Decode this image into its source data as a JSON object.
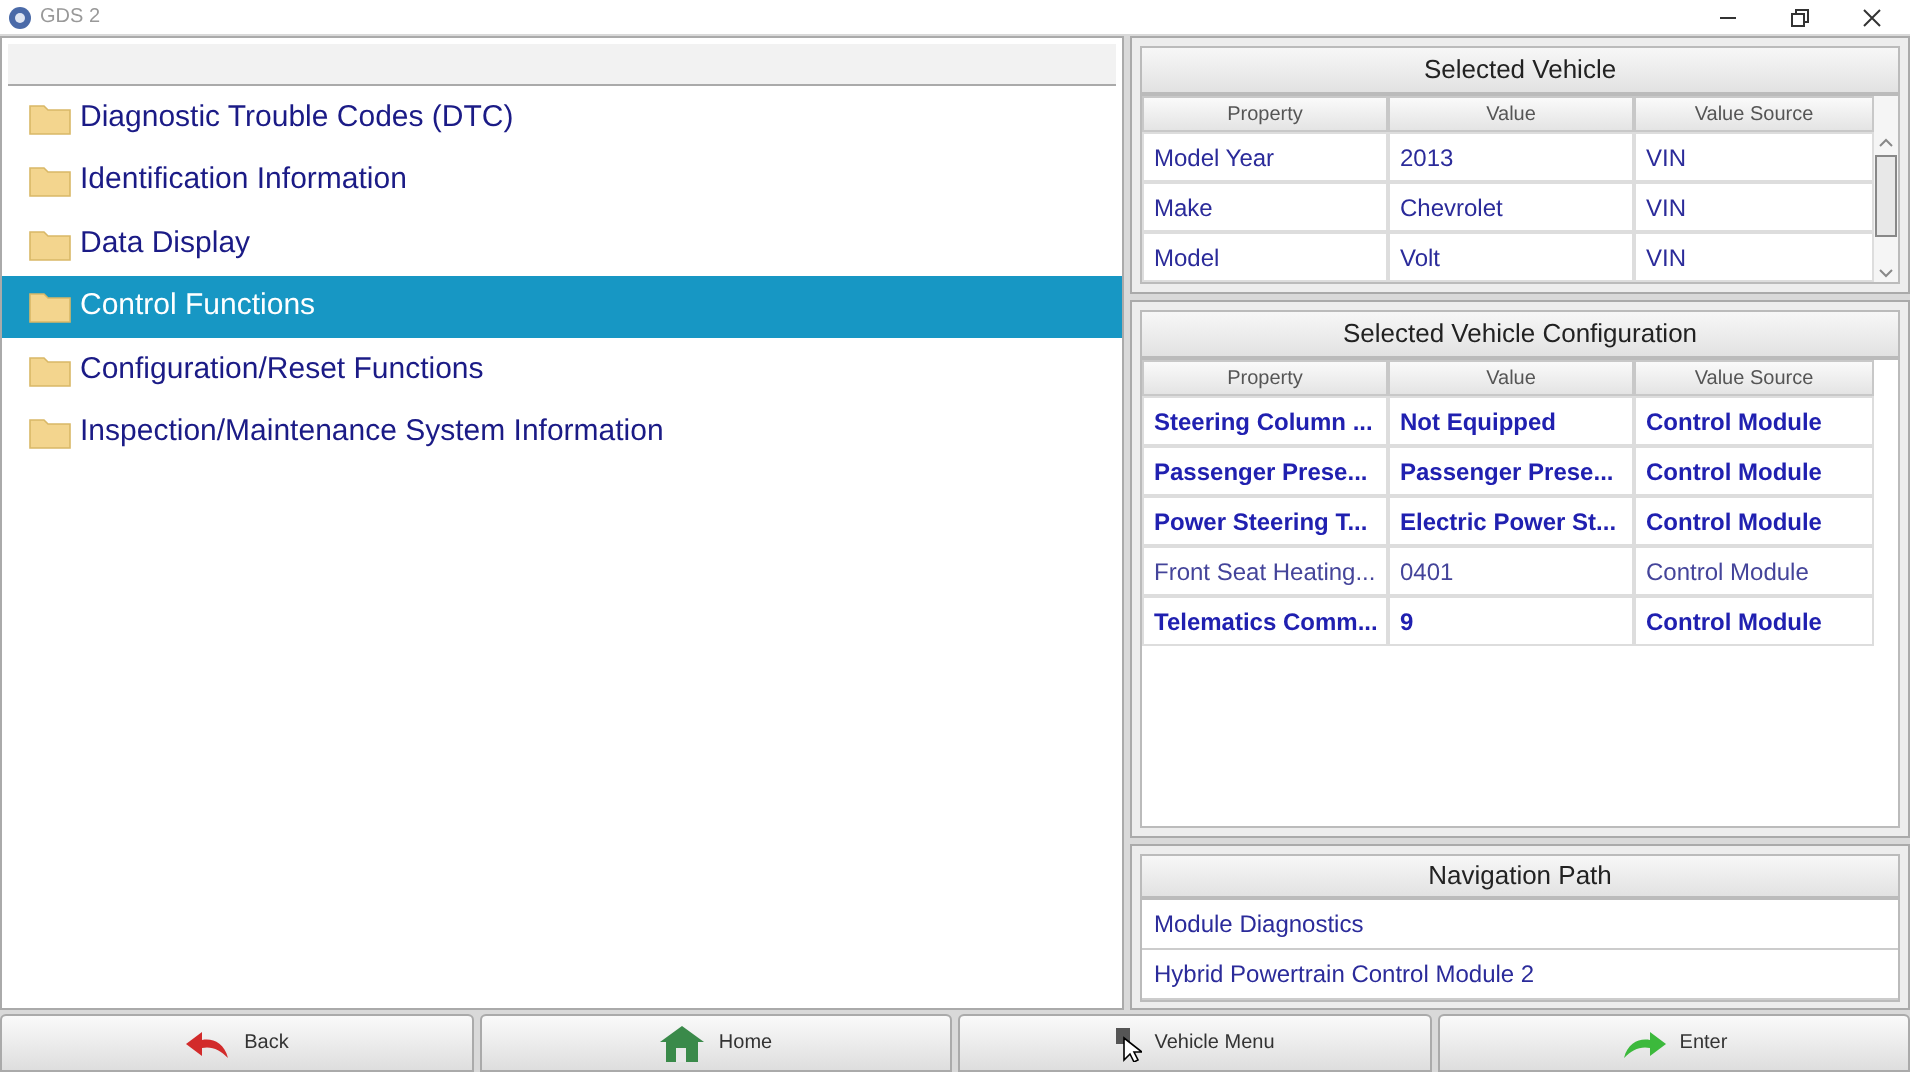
{
  "window": {
    "title": "GDS 2"
  },
  "menu": [
    {
      "label": "Diagnostic Trouble Codes (DTC)",
      "selected": false
    },
    {
      "label": "Identification Information",
      "selected": false
    },
    {
      "label": "Data Display",
      "selected": false
    },
    {
      "label": "Control Functions",
      "selected": true
    },
    {
      "label": "Configuration/Reset Functions",
      "selected": false
    },
    {
      "label": "Inspection/Maintenance System Information",
      "selected": false
    }
  ],
  "selected_vehicle": {
    "title": "Selected Vehicle",
    "columns": [
      "Property",
      "Value",
      "Value Source"
    ],
    "rows": [
      [
        "Model Year",
        "2013",
        "VIN"
      ],
      [
        "Make",
        "Chevrolet",
        "VIN"
      ],
      [
        "Model",
        "Volt",
        "VIN"
      ]
    ]
  },
  "configuration": {
    "title": "Selected Vehicle Configuration",
    "columns": [
      "Property",
      "Value",
      "Value Source"
    ],
    "rows": [
      {
        "cells": [
          "Steering Column ...",
          "Not Equipped",
          "Control Module"
        ],
        "emphasized": true
      },
      {
        "cells": [
          "Passenger Prese...",
          "Passenger Prese...",
          "Control Module"
        ],
        "emphasized": true
      },
      {
        "cells": [
          "Power Steering T...",
          "Electric Power St...",
          "Control Module"
        ],
        "emphasized": true
      },
      {
        "cells": [
          "Front Seat Heating...",
          "0401",
          "Control Module"
        ],
        "emphasized": false
      },
      {
        "cells": [
          "Telematics Comm...",
          "9",
          "Control Module"
        ],
        "emphasized": true
      }
    ]
  },
  "navigation_path": {
    "title": "Navigation Path",
    "items": [
      "Module Diagnostics",
      "Hybrid Powertrain Control Module 2"
    ]
  },
  "buttons": [
    {
      "kind": "back",
      "label": "Back"
    },
    {
      "kind": "home",
      "label": "Home"
    },
    {
      "kind": "vehicle",
      "label": "Vehicle Menu"
    },
    {
      "kind": "enter",
      "label": "Enter"
    }
  ]
}
